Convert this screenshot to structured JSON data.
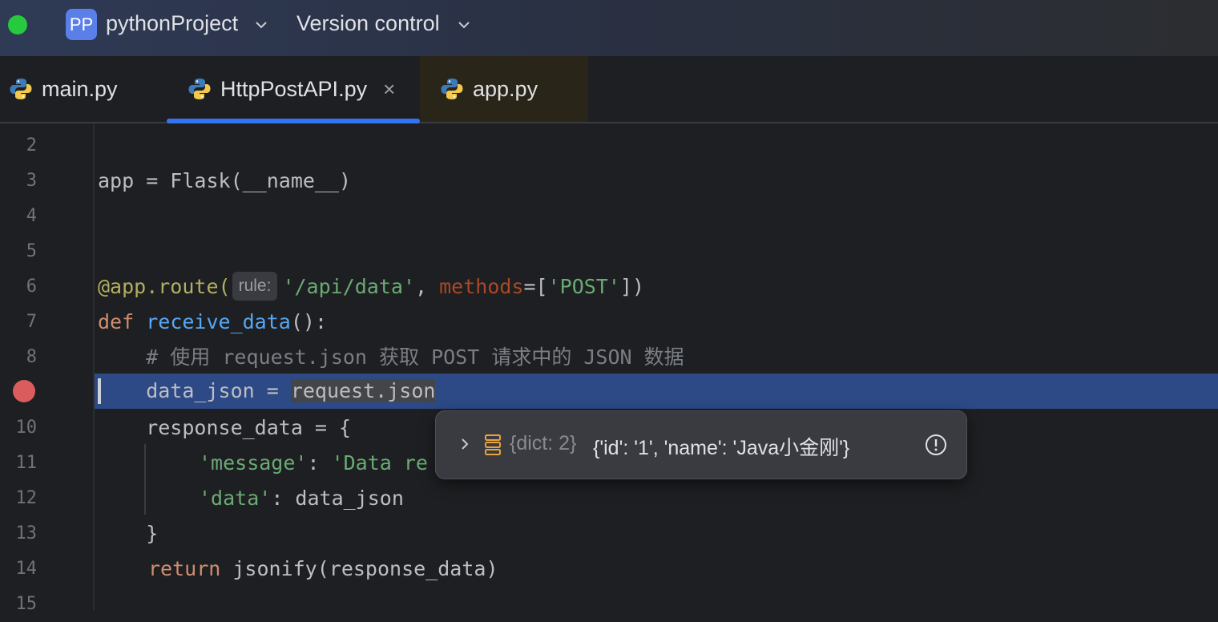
{
  "titlebar": {
    "project_badge": "PP",
    "project_name": "pythonProject",
    "vcs": "Version control"
  },
  "tabs": [
    {
      "label": "main.py",
      "active": false
    },
    {
      "label": "HttpPostAPI.py",
      "active": true,
      "close": "×"
    },
    {
      "label": "app.py",
      "active": false
    }
  ],
  "lines": [
    {
      "n": "2"
    },
    {
      "n": "3"
    },
    {
      "n": "4"
    },
    {
      "n": "5"
    },
    {
      "n": "6"
    },
    {
      "n": "7"
    },
    {
      "n": "8"
    },
    {
      "n": "9"
    },
    {
      "n": "10"
    },
    {
      "n": "11"
    },
    {
      "n": "12"
    },
    {
      "n": "13"
    },
    {
      "n": "14"
    },
    {
      "n": "15"
    }
  ],
  "code": {
    "l3": "app = Flask(__name__)",
    "l6_deco": "@app.route(",
    "l6_hint": "rule:",
    "l6_str": "'/api/data'",
    "l6_comma": ", ",
    "l6_param": "methods",
    "l6_eq": "=[",
    "l6_post": "'POST'",
    "l6_end": "])",
    "l7_def": "def",
    "l7_fn": "receive_data",
    "l7_end": "():",
    "l8_cmt": "    # 使用 request.json 获取 POST 请求中的 JSON 数据",
    "l9_a": "    data_json = ",
    "l9_sel": "request.json",
    "l10": "    response_data = {",
    "l11_str1": "'message'",
    "l11_colon": ": ",
    "l11_str2": "'Data re",
    "l12_str": "'data'",
    "l12_rest": ": data_json",
    "l13": "    }",
    "l14_kw": "return",
    "l14_rest": " jsonify(response_data)"
  },
  "popup": {
    "type": "{dict: 2}",
    "value": "{'id': '1', 'name': 'Java小金刚'}"
  },
  "colors": {
    "accent": "#3574f0",
    "breakpoint": "#db5c5c",
    "execution_line": "#2d4a86"
  }
}
